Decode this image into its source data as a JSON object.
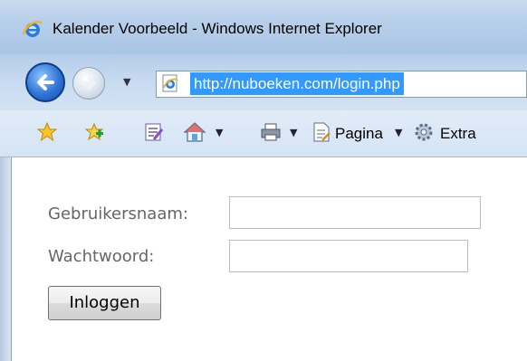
{
  "window": {
    "title": "Kalender Voorbeeld - Windows Internet Explorer"
  },
  "navigation": {
    "url": "http://nuboeken.com/login.php",
    "back_icon": "back-arrow-icon",
    "forward_icon": "forward-arrow-icon"
  },
  "toolbar": {
    "page_label": "Pagina",
    "extra_label": "Extra",
    "icons": [
      "favorites-star-icon",
      "add-favorites-icon",
      "feeds-icon",
      "home-icon",
      "print-icon",
      "page-icon",
      "gear-icon"
    ]
  },
  "form": {
    "username_label": "Gebruikersnaam:",
    "username_value": "",
    "password_label": "Wachtwoord:",
    "password_value": "",
    "submit_label": "Inloggen"
  },
  "colors": {
    "selection": "#3399ff",
    "label_text": "#666666"
  }
}
